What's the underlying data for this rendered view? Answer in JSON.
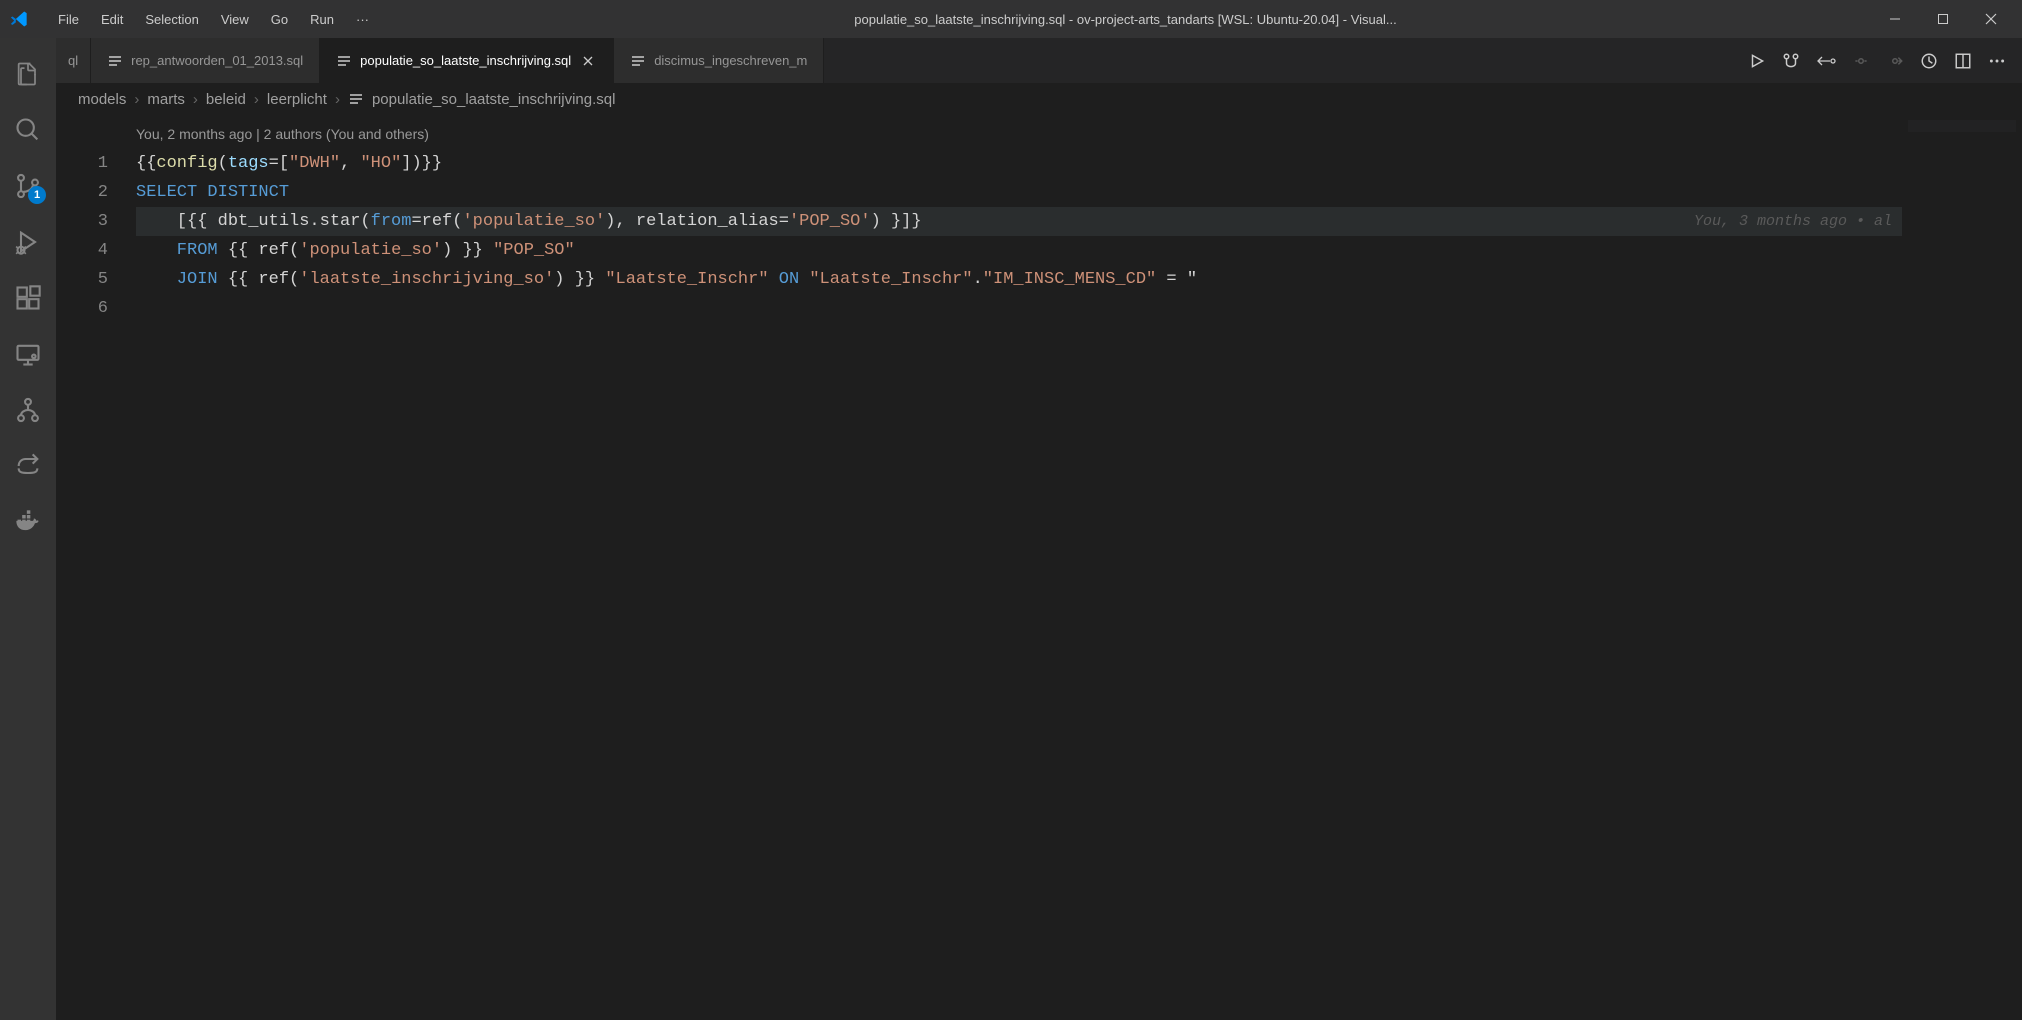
{
  "window": {
    "title": "populatie_so_laatste_inschrijving.sql - ov-project-arts_tandarts [WSL: Ubuntu-20.04] - Visual..."
  },
  "menu": {
    "file": "File",
    "edit": "Edit",
    "selection": "Selection",
    "view": "View",
    "go": "Go",
    "run": "Run",
    "more": "···"
  },
  "activity": {
    "scm_badge": "1"
  },
  "tabs": {
    "overflow": "ql",
    "tab1": "rep_antwoorden_01_2013.sql",
    "tab2": "populatie_so_laatste_inschrijving.sql",
    "tab3": "discimus_ingeschreven_m"
  },
  "breadcrumbs": {
    "p1": "models",
    "p2": "marts",
    "p3": "beleid",
    "p4": "leerplicht",
    "p5": "populatie_so_laatste_inschrijving.sql"
  },
  "codelens": {
    "text": "You, 2 months ago | 2 authors (You and others)"
  },
  "inline_blame": "You, 3 months ago • al",
  "code": {
    "line1_a": "{{",
    "line1_b": "config",
    "line1_c": "(",
    "line1_d": "tags",
    "line1_e": "=[",
    "line1_f": "\"DWH\"",
    "line1_g": ", ",
    "line1_h": "\"HO\"",
    "line1_i": "])}}",
    "line2_a": "SELECT",
    "line2_b": " DISTINCT",
    "line3_a": "    [{{ dbt_utils.star(",
    "line3_b": "from",
    "line3_c": "=ref(",
    "line3_d": "'populatie_so'",
    "line3_e": "), relation_alias=",
    "line3_f": "'POP_SO'",
    "line3_g": ") }]}",
    "line4_a": "    FROM",
    "line4_b": " {{ ref(",
    "line4_c": "'populatie_so'",
    "line4_d": ") }} ",
    "line4_e": "\"POP_SO\"",
    "line5_a": "    JOIN",
    "line5_b": " {{ ref(",
    "line5_c": "'laatste_inschrijving_so'",
    "line5_d": ") }} ",
    "line5_e": "\"Laatste_Inschr\"",
    "line5_f": " ON",
    "line5_g": " ",
    "line5_h": "\"Laatste_Inschr\"",
    "line5_i": ".",
    "line5_j": "\"IM_INSC_MENS_CD\"",
    "line5_k": " = \""
  },
  "line_numbers": [
    "1",
    "2",
    "3",
    "4",
    "5",
    "6"
  ]
}
